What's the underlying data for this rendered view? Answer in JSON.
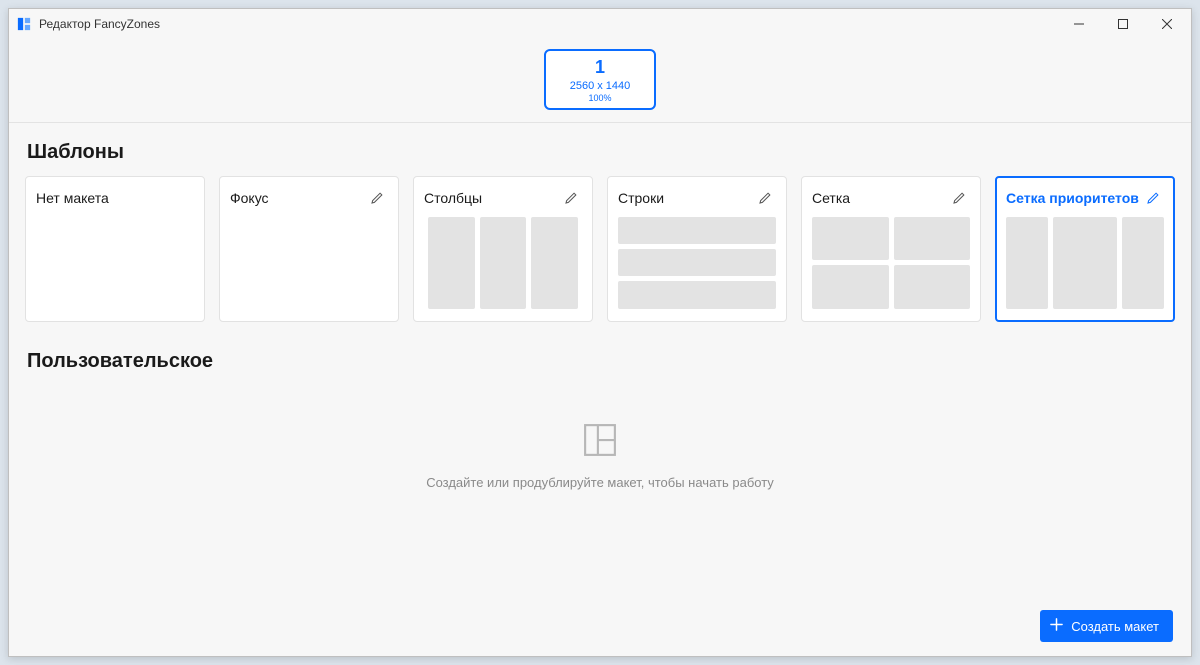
{
  "window": {
    "title": "Редактор FancyZones"
  },
  "monitor": {
    "number": "1",
    "resolution": "2560 x 1440",
    "scale": "100%"
  },
  "sections": {
    "templates": "Шаблоны",
    "custom": "Пользовательское"
  },
  "templates": {
    "no_layout": "Нет макета",
    "focus": "Фокус",
    "columns": "Столбцы",
    "rows": "Строки",
    "grid": "Сетка",
    "priority_grid": "Сетка приоритетов"
  },
  "custom_empty": {
    "message": "Создайте или продублируйте макет, чтобы начать работу"
  },
  "buttons": {
    "create_layout": "Создать макет"
  }
}
